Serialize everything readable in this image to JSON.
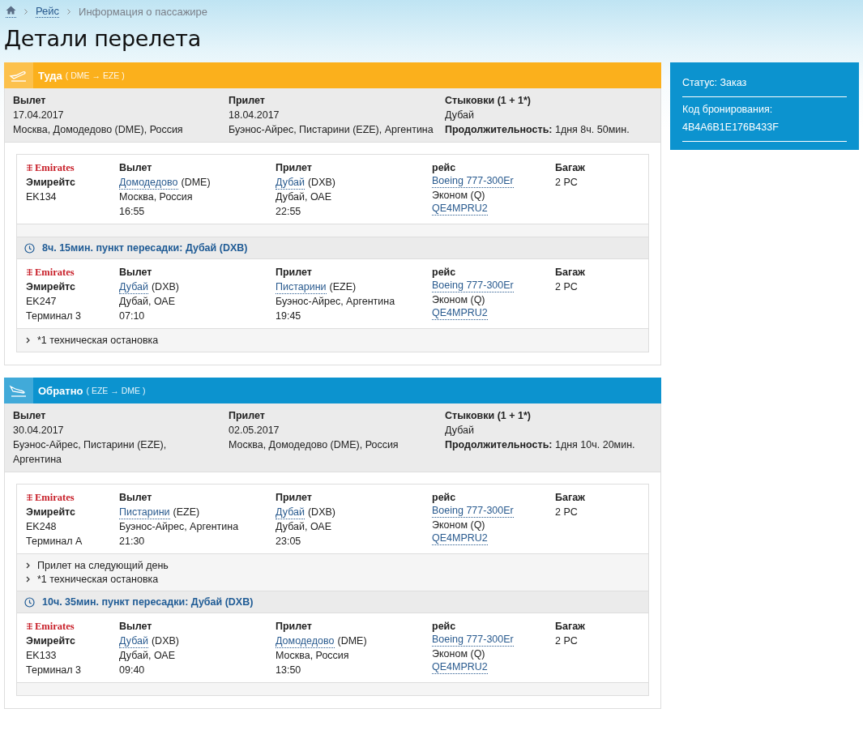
{
  "breadcrumbs": [
    {
      "kind": "home"
    },
    {
      "kind": "link",
      "label": "Рейс"
    },
    {
      "kind": "current",
      "label": "Информация о пассажире"
    }
  ],
  "title": "Детали перелета",
  "directions": [
    {
      "kind": "outbound",
      "title": "Туда",
      "route": "( DME → EZE )",
      "summary": {
        "departure_label": "Вылет",
        "departure_date": "17.04.2017",
        "departure_place": "Москва, Домодедово (DME), Россия",
        "arrival_label": "Прилет",
        "arrival_date": "18.04.2017",
        "arrival_place": "Буэнос-Айрес, Пистарини (EZE), Аргентина",
        "connections_label": "Стыковки (1 + 1*)",
        "connections_city": "Дубай",
        "duration": "**Продолжительность:** 1дня 8ч. 50мин."
      },
      "segments": [
        {
          "kind": "flight",
          "logo": "Emirates",
          "airline": "Эмирейтс",
          "flight_number": "EK134",
          "departure_label": "Вылет",
          "departure_airport": "Домодедово",
          "departure_code": "(DME)",
          "departure_city": "Москва, Россия",
          "departure_time": "16:55",
          "arrival_label": "Прилет",
          "arrival_airport": "Дубай",
          "arrival_code": "(DXB)",
          "arrival_city": "Дубай, ОАЕ",
          "arrival_time": "22:55",
          "flight_label": "рейс",
          "aircraft": "Boeing 777-300Er",
          "cabin": "Эконом (Q)",
          "fare_code": "QE4MPRU2",
          "baggage_label": "Багаж",
          "baggage": "2 PC"
        },
        {
          "kind": "layover",
          "text": "8ч. 15мин. пункт пересадки: Дубай (DXB)"
        },
        {
          "kind": "flight",
          "logo": "Emirates",
          "airline": "Эмирейтс",
          "flight_number": "EK247",
          "terminal": "Терминал 3",
          "departure_label": "Вылет",
          "departure_airport": "Дубай",
          "departure_code": "(DXB)",
          "departure_city": "Дубай, ОАЕ",
          "departure_time": "07:10",
          "arrival_label": "Прилет",
          "arrival_airport": "Пистарини",
          "arrival_code": "(EZE)",
          "arrival_city": "Буэнос-Айрес, Аргентина",
          "arrival_time": "19:45",
          "flight_label": "рейс",
          "aircraft": "Boeing 777-300Er",
          "cabin": "Эконом (Q)",
          "fare_code": "QE4MPRU2",
          "baggage_label": "Багаж",
          "baggage": "2 PC",
          "notes": [
            "*1 техническая остановка"
          ]
        }
      ]
    },
    {
      "kind": "return",
      "title": "Обратно",
      "route": "( EZE → DME )",
      "summary": {
        "departure_label": "Вылет",
        "departure_date": "30.04.2017",
        "departure_place": "Буэнос-Айрес, Пистарини (EZE), Аргентина",
        "arrival_label": "Прилет",
        "arrival_date": "02.05.2017",
        "arrival_place": "Москва, Домодедово (DME), Россия",
        "connections_label": "Стыковки (1 + 1*)",
        "connections_city": "Дубай",
        "duration": "**Продолжительность:** 1дня 10ч. 20мин."
      },
      "segments": [
        {
          "kind": "flight",
          "logo": "Emirates",
          "airline": "Эмирейтс",
          "flight_number": "EK248",
          "terminal": "Терминал A",
          "departure_label": "Вылет",
          "departure_airport": "Пистарини",
          "departure_code": "(EZE)",
          "departure_city": "Буэнос-Айрес, Аргентина",
          "departure_time": "21:30",
          "arrival_label": "Прилет",
          "arrival_airport": "Дубай",
          "arrival_code": "(DXB)",
          "arrival_city": "Дубай, ОАЕ",
          "arrival_time": "23:05",
          "flight_label": "рейс",
          "aircraft": "Boeing 777-300Er",
          "cabin": "Эконом (Q)",
          "fare_code": "QE4MPRU2",
          "baggage_label": "Багаж",
          "baggage": "2 PC",
          "notes": [
            "Прилет на следующий день",
            "*1 техническая остановка"
          ]
        },
        {
          "kind": "layover",
          "text": "10ч. 35мин. пункт пересадки: Дубай (DXB)"
        },
        {
          "kind": "flight",
          "logo": "Emirates",
          "airline": "Эмирейтс",
          "flight_number": "EK133",
          "terminal": "Терминал 3",
          "departure_label": "Вылет",
          "departure_airport": "Дубай",
          "departure_code": "(DXB)",
          "departure_city": "Дубай, ОАЕ",
          "departure_time": "09:40",
          "arrival_label": "Прилет",
          "arrival_airport": "Домодедово",
          "arrival_code": "(DME)",
          "arrival_city": "Москва, Россия",
          "arrival_time": "13:50",
          "flight_label": "рейс",
          "aircraft": "Boeing 777-300Er",
          "cabin": "Эконом (Q)",
          "fare_code": "QE4MPRU2",
          "baggage_label": "Багаж",
          "baggage": "2 PC"
        }
      ]
    }
  ],
  "sidebar": {
    "status": "Статус: Заказ",
    "booking_label": "Код бронирования:",
    "booking_code": "4B4A6B1E176B433F"
  }
}
